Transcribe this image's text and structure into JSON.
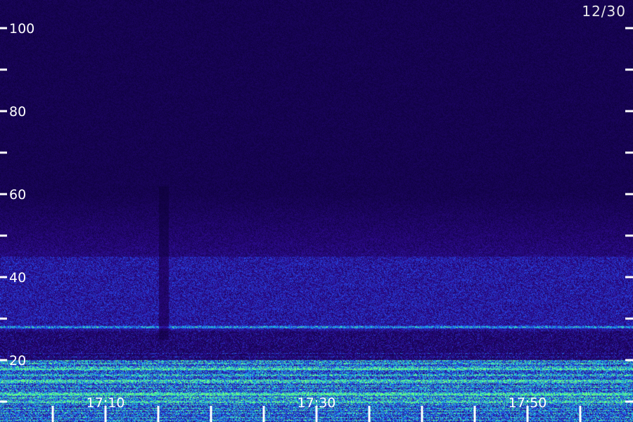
{
  "date_label": "12/30",
  "colors": {
    "background": "#07003a",
    "noise_low": "#2a0a7a",
    "noise_mid": "#2f45d8",
    "noise_high": "#22c8d8",
    "band_highlight": "#5cf0a0",
    "axis": "#ffffff"
  },
  "chart_data": {
    "type": "heatmap",
    "title": "",
    "xlabel": "",
    "ylabel": "",
    "ylim": [
      5,
      107
    ],
    "y_ticks": [
      {
        "value": 100,
        "label": "100"
      },
      {
        "value": 90,
        "label": ""
      },
      {
        "value": 80,
        "label": "80"
      },
      {
        "value": 70,
        "label": ""
      },
      {
        "value": 60,
        "label": "60"
      },
      {
        "value": 50,
        "label": ""
      },
      {
        "value": 40,
        "label": "40"
      },
      {
        "value": 30,
        "label": ""
      },
      {
        "value": 20,
        "label": "20"
      },
      {
        "value": 10,
        "label": ""
      }
    ],
    "x_range_minutes": [
      "17:00",
      "18:00"
    ],
    "x_ticks": [
      {
        "time": "17:05",
        "label": ""
      },
      {
        "time": "17:10",
        "label": "17:10"
      },
      {
        "time": "17:15",
        "label": ""
      },
      {
        "time": "17:20",
        "label": ""
      },
      {
        "time": "17:25",
        "label": ""
      },
      {
        "time": "17:30",
        "label": "17:30"
      },
      {
        "time": "17:35",
        "label": ""
      },
      {
        "time": "17:40",
        "label": ""
      },
      {
        "time": "17:45",
        "label": ""
      },
      {
        "time": "17:50",
        "label": "17:50"
      },
      {
        "time": "17:55",
        "label": ""
      }
    ],
    "intensity_levels": {
      "above_60": 0.15,
      "from_45_to_60": 0.35,
      "from_28_to_45": 0.5,
      "below_20": 0.75
    },
    "bright_bands": [
      28,
      18,
      15,
      12,
      10
    ],
    "dark_gap_times": [
      "17:15",
      "17:16"
    ]
  }
}
